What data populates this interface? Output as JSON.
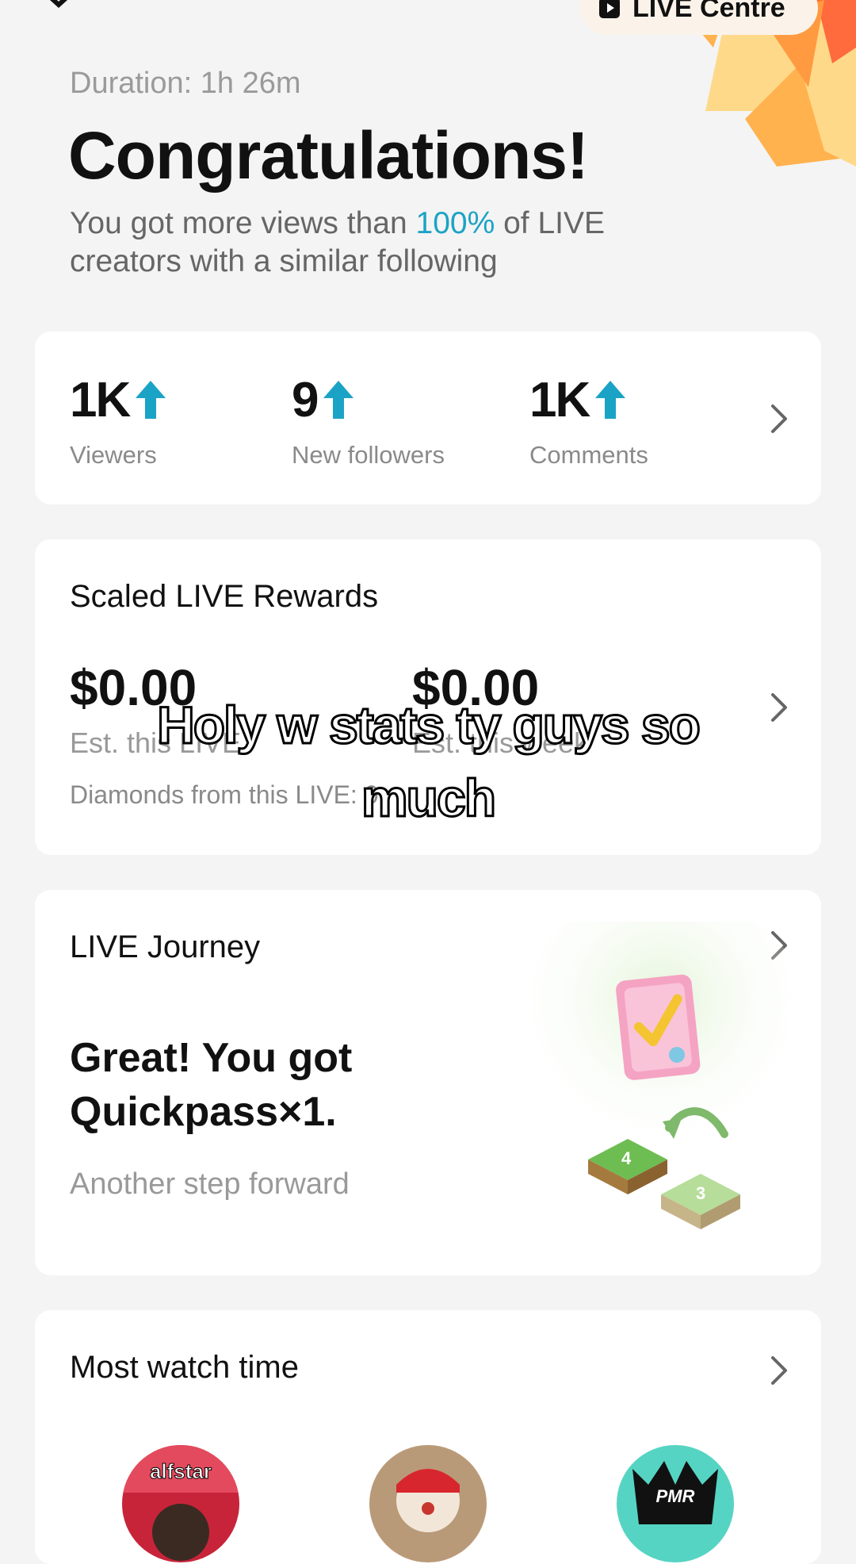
{
  "header": {
    "live_centre_label": "LIVE Centre",
    "duration": "Duration: 1h 26m",
    "title": "Congratulations!",
    "views_prefix": "You got more views than",
    "views_percent": "100%",
    "views_suffix": "of LIVE creators with a similar following"
  },
  "stats": [
    {
      "value": "1K",
      "label": "Viewers"
    },
    {
      "value": "9",
      "label": "New followers"
    },
    {
      "value": "1K",
      "label": "Comments"
    }
  ],
  "rewards": {
    "title": "Scaled LIVE Rewards",
    "live_amount": "$0.00",
    "live_label": "Est. this LIVE",
    "week_amount": "$0.00",
    "week_label": "Est. this week",
    "diamonds_label": "Diamonds from this LIVE: 0"
  },
  "journey": {
    "title": "LIVE Journey",
    "headline": "Great! You got Quickpass×1.",
    "subtext": "Another step forward"
  },
  "watch": {
    "title": "Most watch time",
    "avatars": [
      {
        "label": "alfstar"
      },
      {
        "label": ""
      },
      {
        "label": "PMR"
      }
    ]
  },
  "caption": "Holy w stats ty guys so much",
  "colors": {
    "accent": "#1ba3c6",
    "background": "#f4f4f4",
    "card": "#ffffff"
  }
}
